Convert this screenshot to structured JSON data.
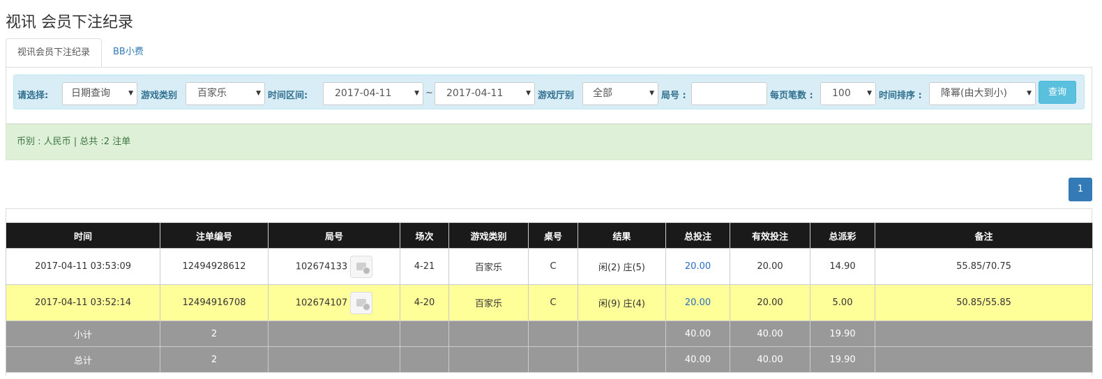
{
  "page_title": "视讯 会员下注纪录",
  "tabs": [
    {
      "label": "视讯会员下注纪录",
      "active": true
    },
    {
      "label": "BB小费",
      "active": false
    }
  ],
  "filters": {
    "select_label": "请选择:",
    "select_value": "日期查询",
    "game_type_label": "游戏类别",
    "game_type_value": "百家乐",
    "time_range_label": "时间区间:",
    "date_from": "2017-04-11",
    "tilde": "~",
    "date_to": "2017-04-11",
    "hall_label": "游戏厅别",
    "hall_value": "全部",
    "round_label": "局号 :",
    "round_value": "",
    "per_page_label": "每页笔数 :",
    "per_page_value": "100",
    "sort_label": "时间排序 :",
    "sort_value": "降幂(由大到小)",
    "query_label": "查询"
  },
  "summary_text": "币别 : 人民币 | 总共 :2 注单",
  "pagination": {
    "current": "1"
  },
  "table": {
    "headers": [
      "时间",
      "注单编号",
      "局号",
      "场次",
      "游戏类别",
      "桌号",
      "结果",
      "总投注",
      "有效投注",
      "总派彩",
      "备注"
    ],
    "rows": [
      {
        "time": "2017-04-11 03:53:09",
        "bet_id": "12494928612",
        "round": "102674133",
        "session": "4-21",
        "game": "百家乐",
        "table": "C",
        "result": "闲(2) 庄(5)",
        "total_bet": "20.00",
        "valid_bet": "20.00",
        "payout": "14.90",
        "note": "55.85/70.75"
      },
      {
        "time": "2017-04-11 03:52:14",
        "bet_id": "12494916708",
        "round": "102674107",
        "session": "4-20",
        "game": "百家乐",
        "table": "C",
        "result": "闲(9) 庄(4)",
        "total_bet": "20.00",
        "valid_bet": "20.00",
        "payout": "5.00",
        "note": "50.85/55.85"
      }
    ],
    "subtotal": {
      "label": "小计",
      "count": "2",
      "total_bet": "40.00",
      "valid_bet": "40.00",
      "payout": "19.90"
    },
    "total": {
      "label": "总计",
      "count": "2",
      "total_bet": "40.00",
      "valid_bet": "40.00",
      "payout": "19.90"
    }
  },
  "icons": {
    "replay": "video-replay-icon",
    "caret": "chevron-down-icon"
  },
  "colors": {
    "header_bg": "#1a1a1a",
    "even_row": "#ffff99",
    "sum_row": "#999999",
    "link": "#337ab7",
    "query_btn": "#5bc0de"
  }
}
